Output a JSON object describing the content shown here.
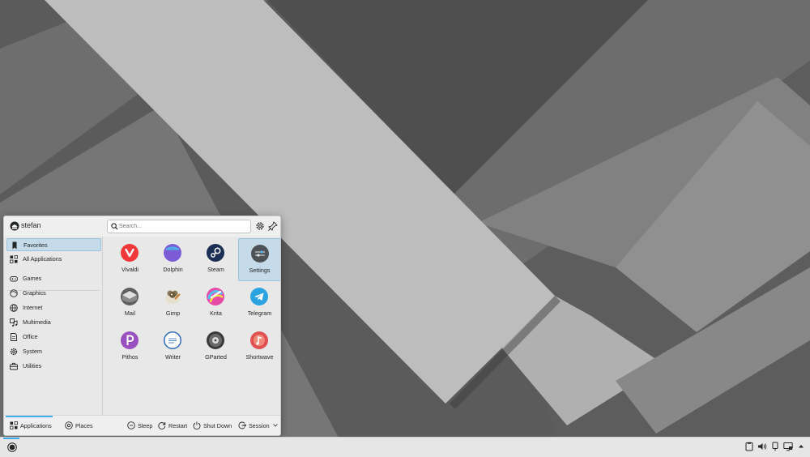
{
  "user": {
    "name": "stefan"
  },
  "search": {
    "placeholder": "Search..."
  },
  "header": {
    "configure_icon": "gear-icon",
    "pin_icon": "pin-icon"
  },
  "sidebar": {
    "items": [
      {
        "label": "Favorites",
        "icon": "bookmark-icon",
        "active": true
      },
      {
        "label": "All Applications",
        "icon": "grid-icon"
      },
      {
        "label": "Games",
        "icon": "gamepad-icon"
      },
      {
        "label": "Graphics",
        "icon": "palette-icon"
      },
      {
        "label": "Internet",
        "icon": "globe-icon"
      },
      {
        "label": "Multimedia",
        "icon": "multimedia-icon"
      },
      {
        "label": "Office",
        "icon": "document-icon"
      },
      {
        "label": "System",
        "icon": "gear-icon"
      },
      {
        "label": "Utilities",
        "icon": "toolbox-icon"
      }
    ]
  },
  "apps": [
    {
      "label": "Vivaldi",
      "icon": "vivaldi-icon",
      "color": "#ef3939"
    },
    {
      "label": "Dolphin",
      "icon": "dolphin-icon",
      "color": "#7c5cd6"
    },
    {
      "label": "Steam",
      "icon": "steam-icon",
      "color": "#1b2f55"
    },
    {
      "label": "Settings",
      "icon": "settings-icon",
      "color": "#4d5257",
      "active": true
    },
    {
      "label": "Mail",
      "icon": "mail-icon",
      "color": "#6b6b6b"
    },
    {
      "label": "Gimp",
      "icon": "gimp-icon",
      "color": "#8a7a5a"
    },
    {
      "label": "Krita",
      "icon": "krita-icon",
      "color": "#e84aa8"
    },
    {
      "label": "Telegram",
      "icon": "telegram-icon",
      "color": "#2aa3e0"
    },
    {
      "label": "Pithos",
      "icon": "pithos-icon",
      "color": "#9a4fc0"
    },
    {
      "label": "Writer",
      "icon": "writer-icon",
      "color": "#2f6db5"
    },
    {
      "label": "GParted",
      "icon": "gparted-icon",
      "color": "#3a3a3a"
    },
    {
      "label": "Shortwave",
      "icon": "shortwave-icon",
      "color": "#e05050"
    }
  ],
  "footer": {
    "tabs": [
      {
        "label": "Applications",
        "active": true
      },
      {
        "label": "Places"
      }
    ],
    "actions": [
      {
        "label": "Sleep"
      },
      {
        "label": "Restart"
      },
      {
        "label": "Shut Down"
      },
      {
        "label": "Session"
      }
    ]
  },
  "colors": {
    "accent": "#3daee9",
    "selection": "#c5dbea"
  }
}
